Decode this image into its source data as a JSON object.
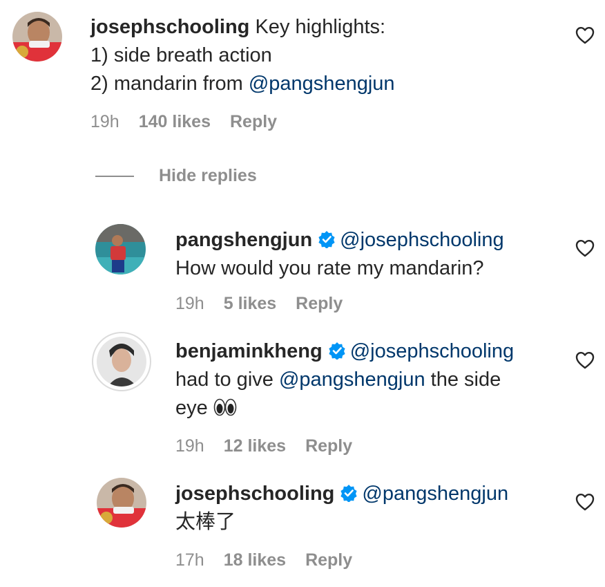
{
  "comments": [
    {
      "username": "josephschooling",
      "text_lead": "Key highlights:",
      "line2": "1) side breath action",
      "line3_prefix": "2) mandarin from ",
      "line3_mention": "@pangshengjun",
      "time": "19h",
      "likes": "140 likes",
      "reply": "Reply",
      "avatar_icon": "swimmer-with-medal-avatar"
    }
  ],
  "hide_replies_label": "Hide replies",
  "replies": [
    {
      "username": "pangshengjun",
      "verified": true,
      "mention": "@josephschooling",
      "line2": "How would you rate my mandarin?",
      "time": "19h",
      "likes": "5 likes",
      "reply": "Reply",
      "avatar_icon": "swimmer-poolside-avatar"
    },
    {
      "username": "benjaminkheng",
      "verified": true,
      "mention": "@josephschooling",
      "line2_prefix": "had to give ",
      "line2_mention": "@pangshengjun",
      "line2_suffix": " the side",
      "line3": "eye",
      "emoji": "eyes-emoji",
      "time": "19h",
      "likes": "12 likes",
      "reply": "Reply",
      "avatar_icon": "person-portrait-avatar"
    },
    {
      "username": "josephschooling",
      "verified": true,
      "mention": "@pangshengjun",
      "line2": "太棒了",
      "time": "17h",
      "likes": "18 likes",
      "reply": "Reply",
      "avatar_icon": "swimmer-with-medal-avatar"
    }
  ],
  "colors": {
    "text": "#262626",
    "secondary": "#8e8e8e",
    "mention": "#00376b",
    "verified": "#0095f6"
  }
}
